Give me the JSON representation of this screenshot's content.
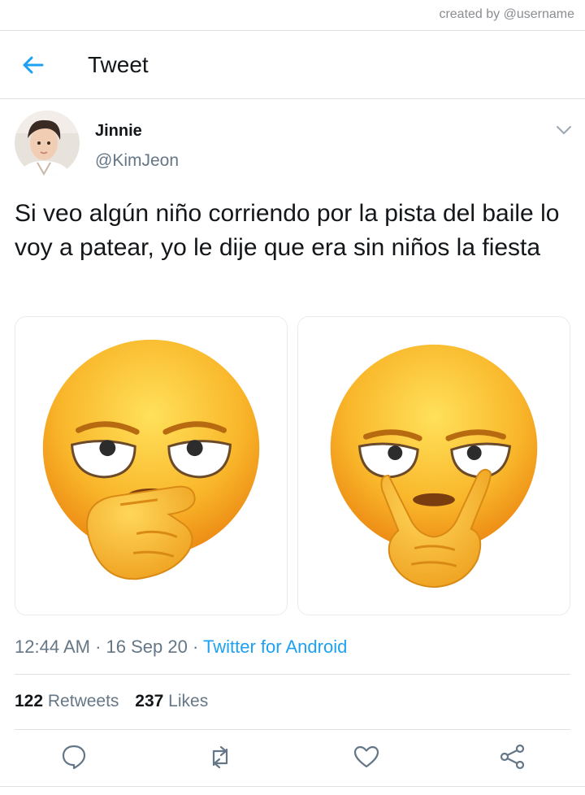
{
  "watermark": "created by @username",
  "header": {
    "title": "Tweet",
    "back_icon": "arrow-left-icon"
  },
  "tweet": {
    "author_name": "Jinnie",
    "author_handle": "@KimJeon",
    "text": "Si veo algún niño corriendo por la pista del baile lo voy a patear, yo le dije que era sin niños la fiesta",
    "media": [
      {
        "description": "emoji-glaring-pointing-finger"
      },
      {
        "description": "emoji-glaring-peace-sign-eyes"
      }
    ],
    "time": "12:44 AM",
    "date": "16 Sep 20",
    "separator": "·",
    "source": "Twitter for Android",
    "retweets_count": "122",
    "retweets_label": "Retweets",
    "likes_count": "237",
    "likes_label": "Likes"
  },
  "actions": [
    "reply-icon",
    "retweet-icon",
    "like-icon",
    "share-icon"
  ],
  "colors": {
    "accent": "#1da1f2",
    "text": "#14171a",
    "muted": "#657786",
    "divider": "#dfe2e5"
  }
}
